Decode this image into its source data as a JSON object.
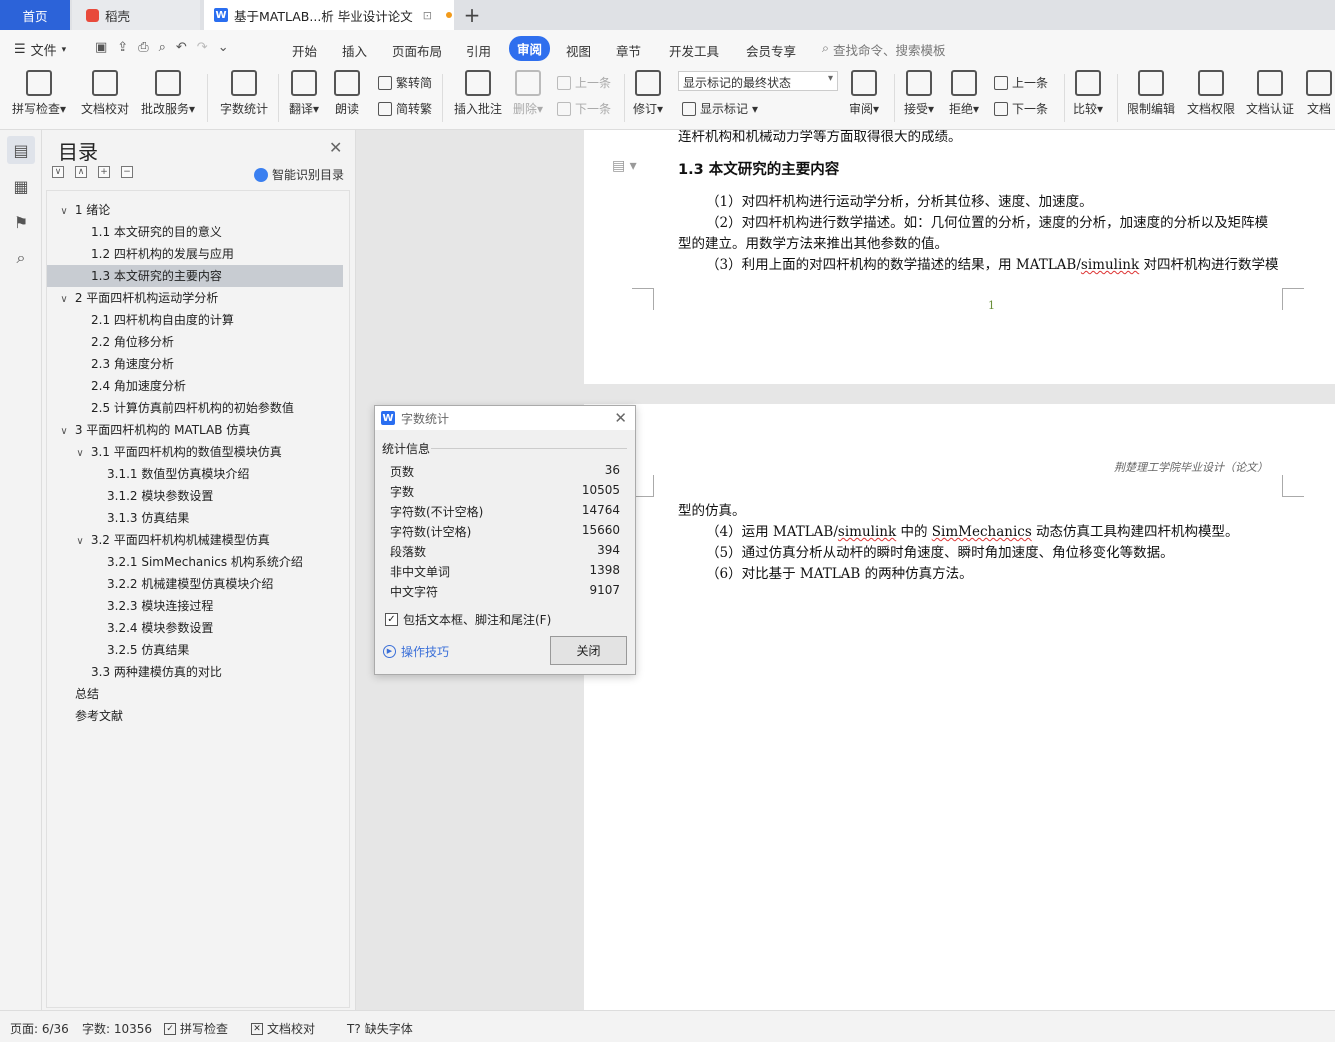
{
  "tabs": {
    "home": "首页",
    "daoke": "稻壳",
    "doc": "基于MATLAB...析 毕业设计论文",
    "add": "+"
  },
  "menu": {
    "file": "文件",
    "items": [
      "开始",
      "插入",
      "页面布局",
      "引用",
      "审阅",
      "视图",
      "章节",
      "开发工具",
      "会员专享"
    ],
    "active": "审阅",
    "search_placeholder": "查找命令、搜索模板"
  },
  "ribbon": {
    "spell_check": "拼写检查",
    "doc_proof": "文档校对",
    "batch_service": "批改服务",
    "word_count": "字数统计",
    "translate": "翻译",
    "read_aloud": "朗读",
    "to_traditional": "繁转简",
    "to_simplified": "简转繁",
    "insert_comment": "插入批注",
    "delete": "删除",
    "prev_comment": "上一条",
    "next_comment": "下一条",
    "revise": "修订",
    "mark_state": "显示标记的最终状态",
    "show_marks": "显示标记",
    "review": "审阅",
    "accept": "接受",
    "reject": "拒绝",
    "prev_change": "上一条",
    "next_change": "下一条",
    "compare": "比较",
    "restrict_edit": "限制编辑",
    "doc_permission": "文档权限",
    "doc_cert": "文档认证",
    "doc_more": "文档"
  },
  "toc": {
    "title": "目录",
    "smart": "智能识别目录",
    "items": [
      {
        "text": "1  绪论",
        "level": 0,
        "caret": "∨"
      },
      {
        "text": "1.1  本文研究的目的意义",
        "level": 1
      },
      {
        "text": "1.2  四杆机构的发展与应用",
        "level": 1
      },
      {
        "text": "1.3  本文研究的主要内容",
        "level": 1,
        "selected": true
      },
      {
        "text": "2  平面四杆机构运动学分析",
        "level": 0,
        "caret": "∨"
      },
      {
        "text": "2.1  四杆机构自由度的计算",
        "level": 1
      },
      {
        "text": "2.2  角位移分析",
        "level": 1
      },
      {
        "text": "2.3  角速度分析",
        "level": 1
      },
      {
        "text": "2.4  角加速度分析",
        "level": 1
      },
      {
        "text": "2.5  计算仿真前四杆机构的初始参数值",
        "level": 1
      },
      {
        "text": "3  平面四杆机构的 MATLAB 仿真",
        "level": 0,
        "caret": "∨"
      },
      {
        "text": "3.1  平面四杆机构的数值型模块仿真",
        "level": 1,
        "caret": "∨"
      },
      {
        "text": "3.1.1  数值型仿真模块介绍",
        "level": 2
      },
      {
        "text": "3.1.2  模块参数设置",
        "level": 2
      },
      {
        "text": "3.1.3  仿真结果",
        "level": 2
      },
      {
        "text": "3.2  平面四杆机构机械建模型仿真",
        "level": 1,
        "caret": "∨"
      },
      {
        "text": "3.2.1 SimMechanics 机构系统介绍",
        "level": 2
      },
      {
        "text": "3.2.2  机械建模型仿真模块介绍",
        "level": 2
      },
      {
        "text": "3.2.3  模块连接过程",
        "level": 2
      },
      {
        "text": "3.2.4  模块参数设置",
        "level": 2
      },
      {
        "text": "3.2.5  仿真结果",
        "level": 2
      },
      {
        "text": "3.3  两种建模仿真的对比",
        "level": 1
      },
      {
        "text": "总结",
        "level": -1
      },
      {
        "text": "参考文献",
        "level": -1
      }
    ]
  },
  "page1": {
    "top_cut": "连杆机构和机械动力学等方面取得很大的成绩。",
    "heading": "1.3  本文研究的主要内容",
    "p1": "（1）对四杆机构进行运动学分析，分析其位移、速度、加速度。",
    "p2a": "（2）对四杆机构进行数学描述。如：几何位置的分析，速度的分析，加速度的分析以及矩阵模",
    "p2b": "型的建立。用数学方法来推出其他参数的值。",
    "p3": "（3）利用上面的对四杆机构的数学描述的结果，用 MATLAB/",
    "p3_squiggle": "simulink",
    "p3_end": " 对四杆机构进行数学模",
    "page_number": "1"
  },
  "page2": {
    "running_head": "荆楚理工学院毕业设计（论文）",
    "l1": "型的仿真。",
    "l2a": "（4）运用 MATLAB/",
    "l2b": "simulink",
    "l2c": " 中的 ",
    "l2d": "SimMechanics",
    "l2e": "  动态仿真工具构建四杆机构模型。",
    "l3": "（5）通过仿真分析从动杆的瞬时角速度、瞬时角加速度、角位移变化等数据。",
    "l4": "（6）对比基于 MATLAB 的两种仿真方法。"
  },
  "dialog": {
    "title": "字数统计",
    "section": "统计信息",
    "stats": [
      {
        "label": "页数",
        "value": "36"
      },
      {
        "label": "字数",
        "value": "10505"
      },
      {
        "label": "字符数(不计空格)",
        "value": "14764"
      },
      {
        "label": "字符数(计空格)",
        "value": "15660"
      },
      {
        "label": "段落数",
        "value": "394"
      },
      {
        "label": "非中文单词",
        "value": "1398"
      },
      {
        "label": "中文字符",
        "value": "9107"
      }
    ],
    "include": "包括文本框、脚注和尾注(F)",
    "tips": "操作技巧",
    "close": "关闭"
  },
  "status": {
    "page": "页面: 6/36",
    "words": "字数: 10356",
    "spell": "拼写检查",
    "proof": "文档校对",
    "missing_font": "缺失字体"
  },
  "colors": {
    "accent": "#2f6fee",
    "home_tab": "#2c63d9"
  }
}
